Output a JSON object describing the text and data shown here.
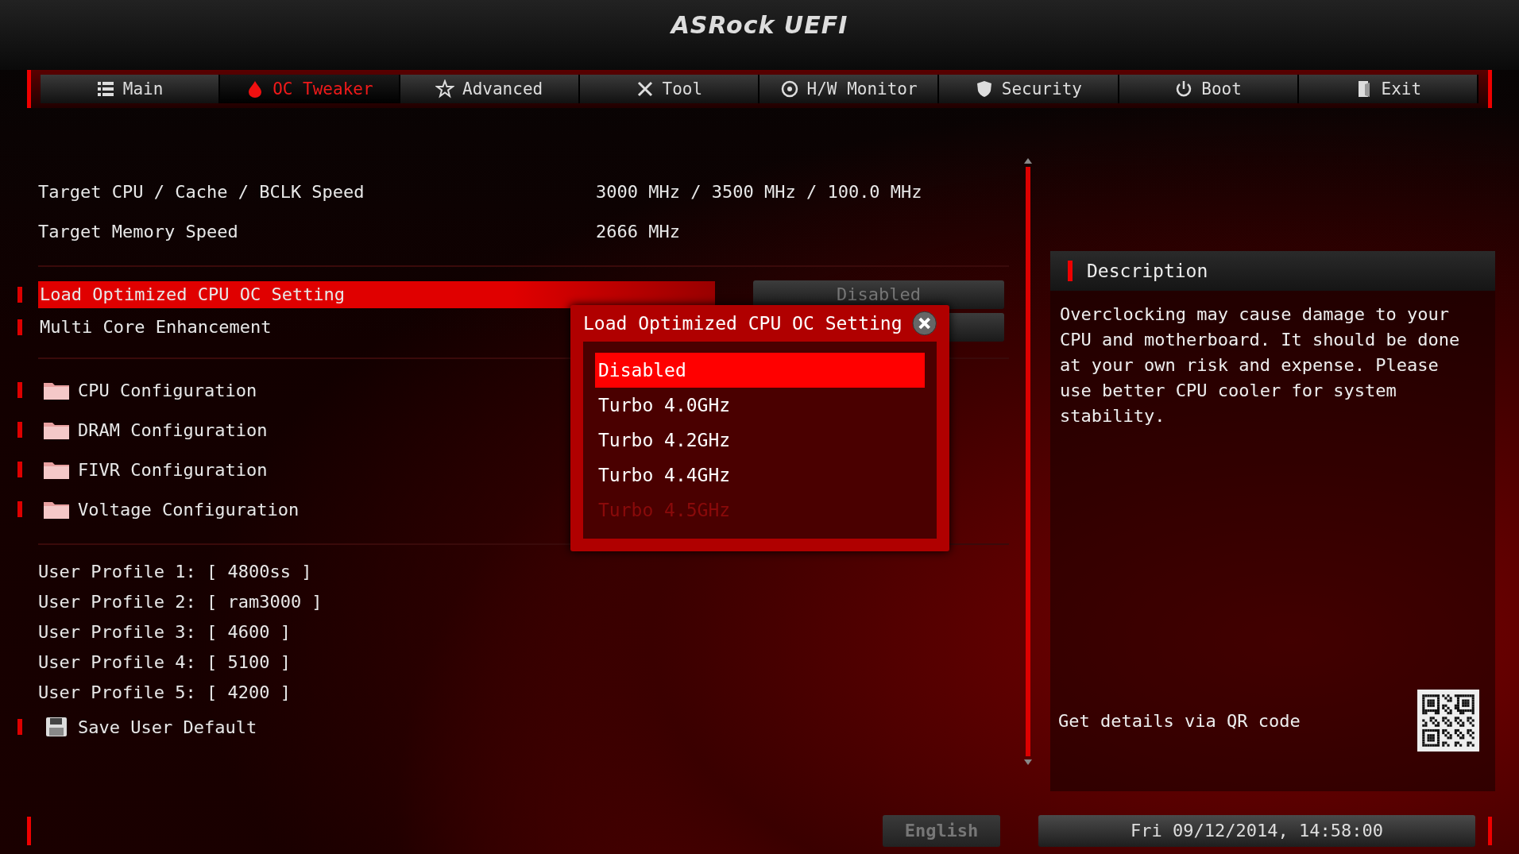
{
  "header": {
    "title": "ASRock UEFI"
  },
  "tabs": [
    {
      "label": "Main",
      "selected": false
    },
    {
      "label": "OC Tweaker",
      "selected": true
    },
    {
      "label": "Advanced",
      "selected": false
    },
    {
      "label": "Tool",
      "selected": false
    },
    {
      "label": "H/W Monitor",
      "selected": false
    },
    {
      "label": "Security",
      "selected": false
    },
    {
      "label": "Boot",
      "selected": false
    },
    {
      "label": "Exit",
      "selected": false
    }
  ],
  "info": [
    {
      "label": "Target CPU / Cache / BCLK Speed",
      "value": "3000 MHz / 3500 MHz / 100.0 MHz"
    },
    {
      "label": "Target Memory Speed",
      "value": "2666 MHz"
    }
  ],
  "settings": [
    {
      "label": "Load Optimized CPU OC Setting",
      "value": "Disabled",
      "selected": true
    },
    {
      "label": "Multi Core Enhancement",
      "selected": false
    }
  ],
  "submenus": [
    {
      "label": "CPU Configuration"
    },
    {
      "label": "DRAM Configuration"
    },
    {
      "label": "FIVR Configuration"
    },
    {
      "label": "Voltage Configuration"
    }
  ],
  "profiles": [
    "User Profile 1: [ 4800ss ]",
    "User Profile 2: [ ram3000 ]",
    "User Profile 3: [ 4600 ]",
    "User Profile 4: [ 5100 ]",
    "User Profile 5: [ 4200 ]"
  ],
  "save_action": {
    "label": "Save User Default"
  },
  "description": {
    "title": "Description",
    "text": "Overclocking may cause damage to your CPU and motherboard. It should be done at your own risk and expense. Please use better CPU cooler for system stability.",
    "qr_label": "Get details via QR code"
  },
  "popup": {
    "title": "Load Optimized CPU OC Setting",
    "options": [
      {
        "label": "Disabled",
        "selected": true,
        "disabled": false
      },
      {
        "label": "Turbo 4.0GHz",
        "selected": false,
        "disabled": false
      },
      {
        "label": "Turbo 4.2GHz",
        "selected": false,
        "disabled": false
      },
      {
        "label": "Turbo 4.4GHz",
        "selected": false,
        "disabled": false
      },
      {
        "label": "Turbo 4.5GHz",
        "selected": false,
        "disabled": true
      }
    ]
  },
  "status_bar": {
    "language": "English",
    "datetime": "Fri 09/12/2014, 14:58:00"
  }
}
